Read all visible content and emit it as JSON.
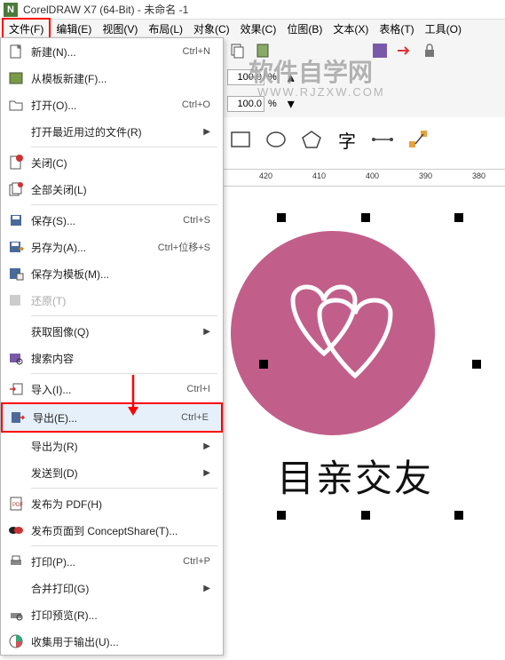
{
  "title": "CorelDRAW X7 (64-Bit) - 未命名 -1",
  "menubar": [
    "文件(F)",
    "编辑(E)",
    "视图(V)",
    "布局(L)",
    "对象(C)",
    "效果(C)",
    "位图(B)",
    "文本(X)",
    "表格(T)",
    "工具(O)"
  ],
  "toolbar": {
    "val1": "100.0",
    "val2": "100.0"
  },
  "ruler": {
    "t0": "420",
    "t1": "410",
    "t2": "400",
    "t3": "390",
    "t4": "380"
  },
  "file_menu": {
    "new": "新建(N)...",
    "new_sc": "Ctrl+N",
    "from_template": "从模板新建(F)...",
    "open": "打开(O)...",
    "open_sc": "Ctrl+O",
    "recent": "打开最近用过的文件(R)",
    "close": "关闭(C)",
    "close_all": "全部关闭(L)",
    "save": "保存(S)...",
    "save_sc": "Ctrl+S",
    "save_as": "另存为(A)...",
    "save_as_sc": "Ctrl+位移+S",
    "save_template": "保存为模板(M)...",
    "revert": "还原(T)",
    "acquire": "获取图像(Q)",
    "search": "搜索内容",
    "import": "导入(I)...",
    "import_sc": "Ctrl+I",
    "export": "导出(E)...",
    "export_sc": "Ctrl+E",
    "export_as": "导出为(R)",
    "send_to": "发送到(D)",
    "pdf": "发布为 PDF(H)",
    "concept": "发布页面到 ConceptShare(T)...",
    "print": "打印(P)...",
    "print_sc": "Ctrl+P",
    "merge_print": "合并打印(G)",
    "print_preview": "打印预览(R)...",
    "collect": "收集用于输出(U)..."
  },
  "canvas_text": "目亲交友",
  "watermark": "软件自学网"
}
